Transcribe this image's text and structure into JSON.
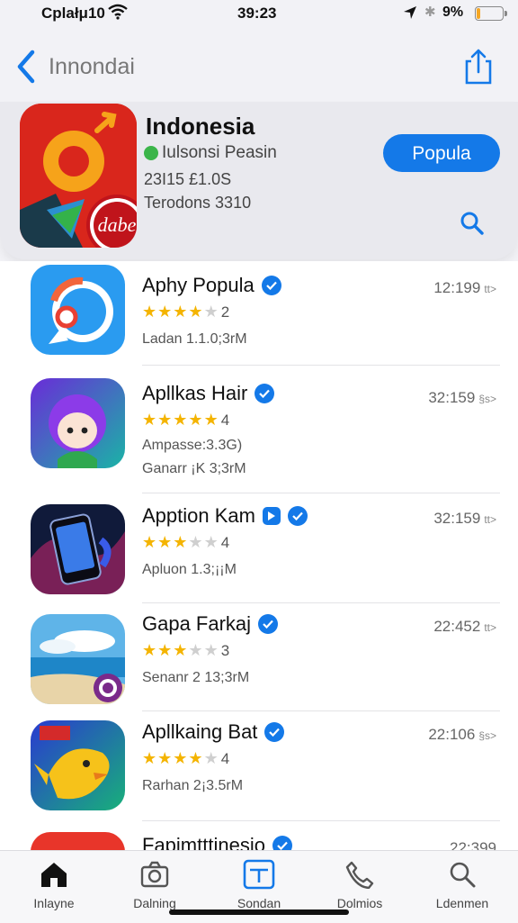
{
  "status_bar": {
    "carrier": "Cplałμ10",
    "time": "39:23",
    "battery_text": "9%",
    "battery_level": 0.15
  },
  "nav": {
    "back_icon": "chevron-left-icon",
    "title": "Innondai",
    "share_icon": "share-icon"
  },
  "featured": {
    "title": "Indonesia",
    "developer": "Iulsonsi Peasin",
    "meta1": "23I15 £1.0S",
    "meta2": "Terodons 3310",
    "button_label": "Popula",
    "search_icon": "search-icon",
    "icon_text": "dabe"
  },
  "apps": [
    {
      "name": "Aphy Popula",
      "rating": 3.5,
      "rating_label": "2",
      "line1": "Ladan 1.1.0;3rM",
      "line2": "",
      "size": "12:199",
      "size_suffix": "tt>",
      "badge": "verified"
    },
    {
      "name": "Apllkas Hair",
      "rating": 5,
      "rating_label": "4",
      "line1": "Ampasse:3.3G)",
      "line2": "Ganarr ¡K 3;3rM",
      "size": "32:159",
      "size_suffix": "§s>",
      "badge": "verified"
    },
    {
      "name": "Apption Kam",
      "rating": 3,
      "rating_label": "4",
      "line1": "Apluon 1.3;¡¡M",
      "line2": "",
      "size": "32:159",
      "size_suffix": "tt>",
      "badge": "play-verified"
    },
    {
      "name": "Gapa Farkaj",
      "rating": 3,
      "rating_label": "3",
      "line1": "Senanr 2 13;3rM",
      "line2": "",
      "size": "22:452",
      "size_suffix": "tt>",
      "badge": "verified"
    },
    {
      "name": "Apllkaing Bat",
      "rating": 4,
      "rating_label": "4",
      "line1": "Rarhan 2¡3.5rM",
      "line2": "",
      "size": "22:106",
      "size_suffix": "§s>",
      "badge": "verified"
    },
    {
      "name": "Fapimtttinesio",
      "rating": 0,
      "rating_label": "",
      "line1": "",
      "line2": "",
      "size": "22:399",
      "size_suffix": "",
      "badge": "verified"
    }
  ],
  "tabs": [
    {
      "label": "Inlayne",
      "icon": "home-icon"
    },
    {
      "label": "Dalning",
      "icon": "camera-icon"
    },
    {
      "label": "Sondan",
      "icon": "add-square-icon"
    },
    {
      "label": "Dolmios",
      "icon": "phone-icon"
    },
    {
      "label": "Ldenmen",
      "icon": "search-icon"
    }
  ],
  "colors": {
    "accent": "#1479e8",
    "star": "#f4b400",
    "verified_green": "#3bb54a"
  }
}
